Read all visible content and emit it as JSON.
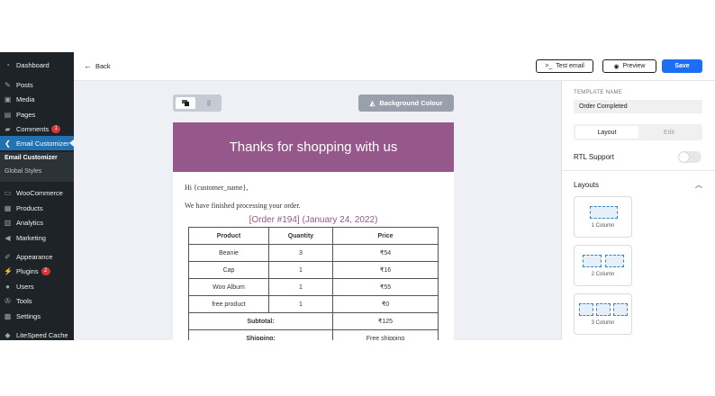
{
  "sidebar": {
    "items": [
      {
        "label": "Dashboard",
        "icon": "dashboard-icon"
      },
      {
        "label": "Posts",
        "icon": "pin-icon"
      },
      {
        "label": "Media",
        "icon": "media-icon"
      },
      {
        "label": "Pages",
        "icon": "pages-icon"
      },
      {
        "label": "Comments",
        "icon": "comment-icon",
        "badge": "1"
      },
      {
        "label": "Email Customizer",
        "icon": "email-customizer-icon"
      },
      {
        "label": "WooCommerce",
        "icon": "woocommerce-icon"
      },
      {
        "label": "Products",
        "icon": "products-icon"
      },
      {
        "label": "Analytics",
        "icon": "analytics-icon"
      },
      {
        "label": "Marketing",
        "icon": "marketing-icon"
      },
      {
        "label": "Appearance",
        "icon": "appearance-icon"
      },
      {
        "label": "Plugins",
        "icon": "plugins-icon",
        "badge": "2"
      },
      {
        "label": "Users",
        "icon": "users-icon"
      },
      {
        "label": "Tools",
        "icon": "tools-icon"
      },
      {
        "label": "Settings",
        "icon": "settings-icon"
      },
      {
        "label": "LiteSpeed Cache",
        "icon": "litespeed-icon"
      }
    ],
    "submenu": [
      "Email Customizer",
      "Global Styles"
    ]
  },
  "topbar": {
    "back_label": "Back",
    "test_email_label": "Test email",
    "preview_label": "Preview",
    "save_label": "Save"
  },
  "canvas": {
    "bg_colour_label": "Background Colour",
    "email": {
      "header_title": "Thanks for shopping with us",
      "greeting": "Hi {customer_name},",
      "message": "We have finished processing your order.",
      "order_heading": "[Order #194] (January 24, 2022)",
      "columns": [
        "Product",
        "Quantity",
        "Price"
      ],
      "rows": [
        {
          "product": "Beanie",
          "qty": "3",
          "price": "₹54"
        },
        {
          "product": "Cap",
          "qty": "1",
          "price": "₹16"
        },
        {
          "product": "Woo Album",
          "qty": "1",
          "price": "₹55"
        },
        {
          "product": "free product",
          "qty": "1",
          "price": "₹0"
        }
      ],
      "subtotal_label": "Subtotal:",
      "subtotal_value": "₹125",
      "shipping_label": "Shipping:",
      "shipping_value": "Free shipping"
    }
  },
  "panel": {
    "template_name_label": "TEMPLATE NAME",
    "template_name_value": "Order Completed",
    "tabs": [
      "Layout",
      "Edit"
    ],
    "rtl_label": "RTL Support",
    "rtl_enabled": false,
    "layouts_title": "Layouts",
    "layouts": [
      "1 Column",
      "2 Column",
      "3 Column"
    ]
  },
  "colors": {
    "sidebar_bg": "#1d2327",
    "sidebar_active": "#2271b1",
    "header_purple": "#96588a",
    "primary_button": "#1c6ff5"
  }
}
